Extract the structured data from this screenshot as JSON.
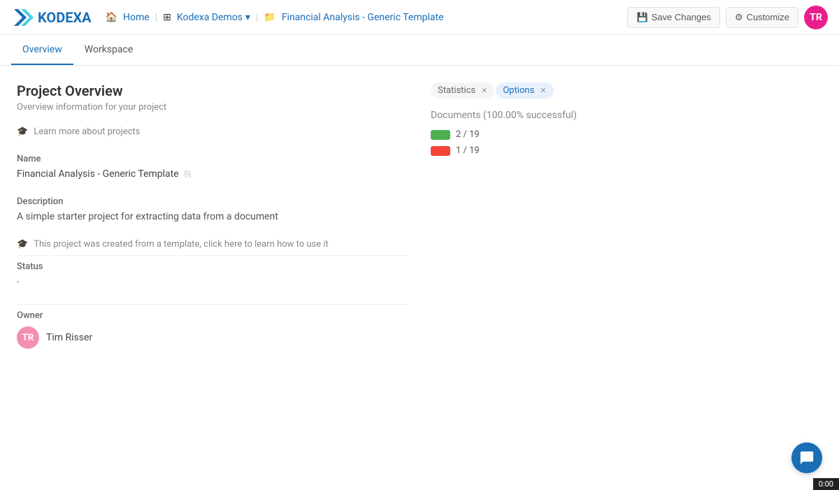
{
  "app": {
    "logo_text": "KODEXA"
  },
  "topnav": {
    "home_label": "Home",
    "demos_label": "Kodexa Demos",
    "breadcrumb_label": "Financial Analysis - Generic Template",
    "save_label": "Save Changes",
    "customize_label": "Customize",
    "avatar_initials": "TR"
  },
  "tabs": [
    {
      "id": "overview",
      "label": "Overview",
      "active": true
    },
    {
      "id": "workspace",
      "label": "Workspace",
      "active": false
    }
  ],
  "main": {
    "title": "Project Overview",
    "subtitle": "Overview information for your project",
    "learn_more": "Learn more about projects",
    "name_label": "Name",
    "name_value": "Financial Analysis - Generic Template",
    "description_label": "Description",
    "description_value": "A simple starter project for extracting data from a document",
    "template_notice": "This project was created from a template, click here to learn how to use it",
    "status_label": "Status",
    "status_value": "-",
    "owner_label": "Owner",
    "owner_name": "Tim Risser",
    "owner_initials": "TR"
  },
  "right_panel": {
    "statistics_tab": "Statistics",
    "options_tab": "Options",
    "documents_title": "Documents (100.00% successful)",
    "stat_green_text": "2 / 19",
    "stat_red_text": "1 / 19"
  },
  "video_bar": {
    "time": "0:00"
  }
}
